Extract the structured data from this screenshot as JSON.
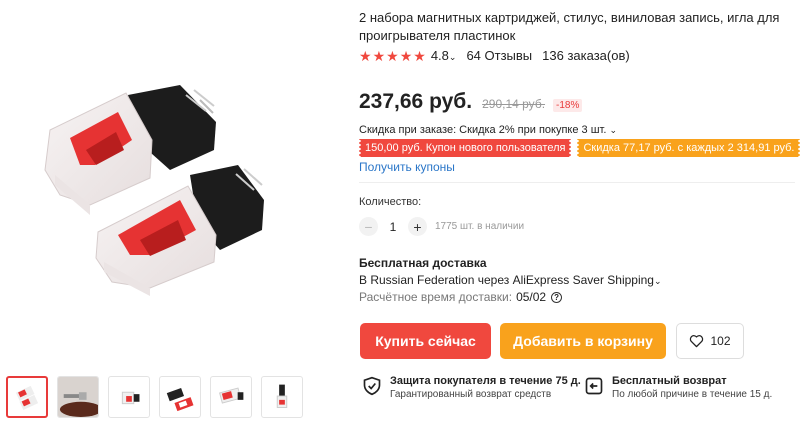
{
  "product": {
    "title": "2 набора магнитных картриджей, стилус, виниловая запись, игла для проигрывателя пластинок",
    "rating": "4.8",
    "reviews": "64 Отзывы",
    "orders": "136 заказа(ов)"
  },
  "price": {
    "current": "237,66 руб.",
    "old": "290,14 руб.",
    "discount": "-18%"
  },
  "promo": {
    "order_discount": "Скидка при заказе: Скидка 2% при покупке 3 шт.",
    "coupon_new_user": "150,00 руб. Купон нового пользователя",
    "coupon_spend": "Скидка 77,17 руб. с каждых 2 314,91 руб.",
    "get_coupons": "Получить купоны"
  },
  "quantity": {
    "label": "Количество:",
    "value": "1",
    "minus": "−",
    "plus": "+",
    "stock": "1775 шт. в наличии"
  },
  "shipping": {
    "title": "Бесплатная доставка",
    "line": "В Russian Federation через AliExpress Saver Shipping",
    "time_label": "Расчётное время доставки:",
    "time_value": "05/02"
  },
  "actions": {
    "buy_now": "Купить сейчас",
    "add_to_cart": "Добавить в корзину",
    "wishlist_count": "102"
  },
  "guarantees": [
    {
      "title": "Защита покупателя в течение 75 д.",
      "subtitle": "Гарантированный возврат средств",
      "icon": "shield-check-icon"
    },
    {
      "title": "Бесплатный возврат",
      "subtitle": "По любой причине в течение 15 д.",
      "icon": "return-icon"
    }
  ],
  "colors": {
    "accent_red": "#f0483e",
    "accent_orange": "#f9a21c",
    "link_blue": "#2a76c8"
  }
}
